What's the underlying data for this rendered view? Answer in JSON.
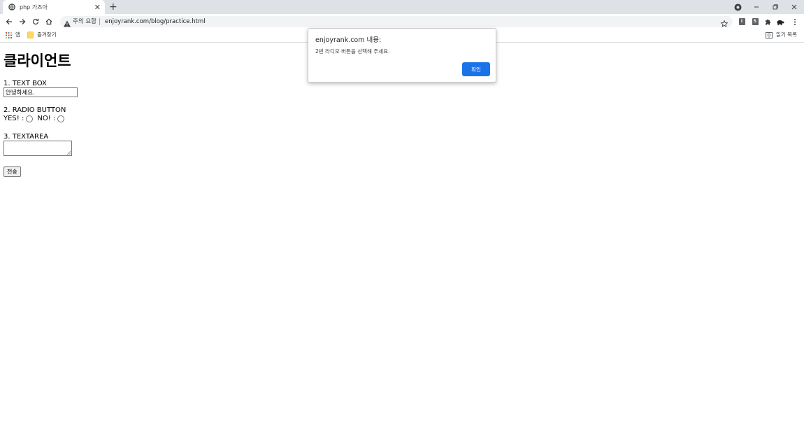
{
  "browser": {
    "tab_title": "php 가즈아",
    "tab_close": "✕",
    "new_tab": "+",
    "security_label": "주의 요함",
    "url": "enjoyrank.com/blog/practice.html",
    "extensions": [
      "I",
      "S"
    ],
    "bookmarks": {
      "apps_label": "앱",
      "folder_label": "즐겨찾기",
      "reading_list_label": "읽기 목록"
    }
  },
  "page": {
    "heading": "클라이언트",
    "textbox_label": "1. TEXT BOX",
    "textbox_value": "안녕하세요.",
    "radio_label": "2. RADIO BUTTON",
    "radio_yes": "YES! :",
    "radio_no": "NO! :",
    "textarea_label": "3. TEXTAREA",
    "submit_label": "전송"
  },
  "dialog": {
    "title": "enjoyrank.com 내용:",
    "message": "2번 라디오 버튼을 선택해 주세요.",
    "ok_label": "확인"
  },
  "colors": {
    "accent": "#1a73e8",
    "tabstrip": "#dee1e6",
    "omnibox": "#f1f3f4"
  }
}
